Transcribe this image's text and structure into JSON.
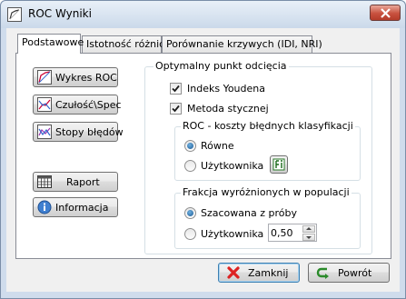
{
  "window": {
    "title": "ROC Wyniki"
  },
  "tabs": [
    {
      "label": "Podstawowe",
      "active": true
    },
    {
      "label": "Istotność różnic",
      "active": false
    },
    {
      "label": "Porównanie krzywych (IDI, NRI)",
      "active": false
    }
  ],
  "side_buttons": {
    "wykres_roc": "Wykres ROC",
    "czulosc_spec": "Czułość\\Spec",
    "stopy_bledow": "Stopy błędów",
    "raport": "Raport",
    "informacja": "Informacja"
  },
  "optimal_point": {
    "title": "Optymalny punkt odcięcia",
    "youden": {
      "label": "Indeks Youdena",
      "checked": true
    },
    "tangent": {
      "label": "Metoda stycznej",
      "checked": true
    }
  },
  "costs": {
    "title": "ROC - koszty błędnych klasyfikacji",
    "options": [
      "Równe",
      "Użytkownika"
    ],
    "selected": "Równe"
  },
  "prevalence": {
    "title": "Frakcja wyróżnionych w populacji",
    "options": [
      "Szacowana z próby",
      "Użytkownika"
    ],
    "selected": "Szacowana z próby",
    "value": "0,50"
  },
  "footer": {
    "close_label": "Zamknij",
    "back_label": "Powrót"
  },
  "colors": {
    "accent_blue": "#1b5a94",
    "close_red": "#c8513f",
    "back_green": "#2a8a2a"
  },
  "icons": {
    "app": "roc-curve-icon",
    "wykres_roc": "roc-chart-icon",
    "czulosc_spec": "sensitivity-chart-icon",
    "stopy_bledow": "error-rates-chart-icon",
    "raport": "table-grid-icon",
    "informacja": "info-icon",
    "cost_editor": "matrix-edit-icon",
    "close": "red-x-icon",
    "back": "green-arrow-icon"
  }
}
